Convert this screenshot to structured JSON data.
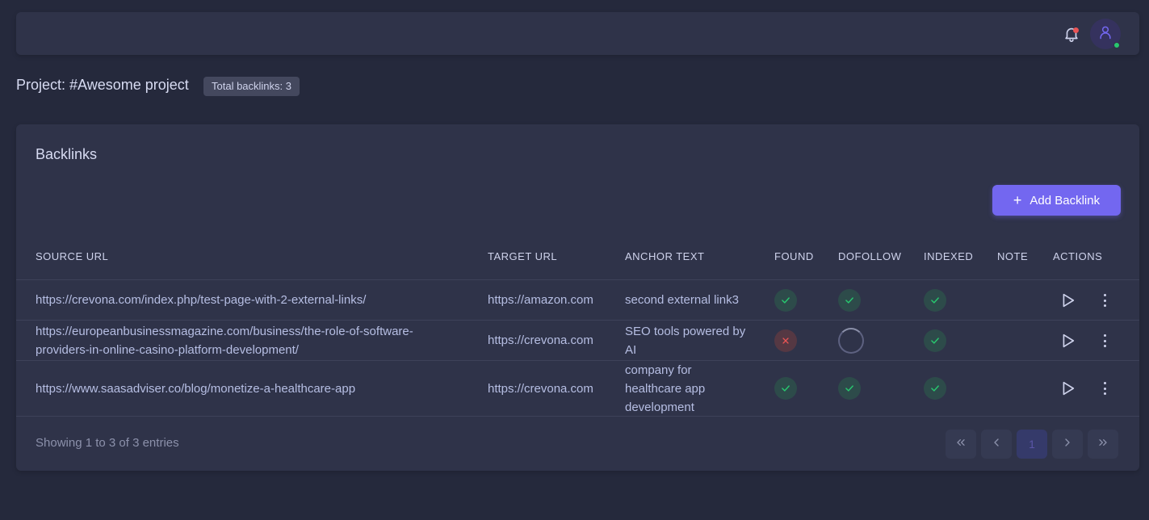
{
  "header": {
    "bell_icon": "bell-icon",
    "avatar_icon": "user-icon"
  },
  "project": {
    "title": "Project: #Awesome project",
    "total_badge": "Total backlinks: 3"
  },
  "card": {
    "title": "Backlinks",
    "add_button_label": "Add Backlink"
  },
  "table": {
    "columns": [
      "SOURCE URL",
      "TARGET URL",
      "ANCHOR TEXT",
      "FOUND",
      "DOFOLLOW",
      "INDEXED",
      "NOTE",
      "ACTIONS"
    ],
    "rows": [
      {
        "source_lines": [
          "https://crevona.com/index.php/test-page-with-2-external-links/"
        ],
        "target": "https://amazon.com",
        "anchor_lines": [
          "second external link3"
        ],
        "found": "ok",
        "dofollow": "ok",
        "indexed": "ok",
        "note": ""
      },
      {
        "source_lines": [
          "https://europeanbusinessmagazine.com/business/the-role-of-software-",
          "providers-in-online-casino-platform-development/"
        ],
        "target": "https://crevona.com",
        "anchor_lines": [
          "SEO tools powered by",
          "AI"
        ],
        "found": "fail",
        "dofollow": "loading",
        "indexed": "ok",
        "note": ""
      },
      {
        "source_lines": [
          "https://www.saasadviser.co/blog/monetize-a-healthcare-app"
        ],
        "target": "https://crevona.com",
        "anchor_lines": [
          "company for",
          "healthcare app",
          "development"
        ],
        "found": "ok",
        "dofollow": "ok",
        "indexed": "ok",
        "note": ""
      }
    ]
  },
  "footer": {
    "showing": "Showing 1 to 3 of 3 entries",
    "current_page": "1"
  },
  "colors": {
    "accent": "#7367f0",
    "success": "#28c76f",
    "danger": "#ea5455"
  }
}
